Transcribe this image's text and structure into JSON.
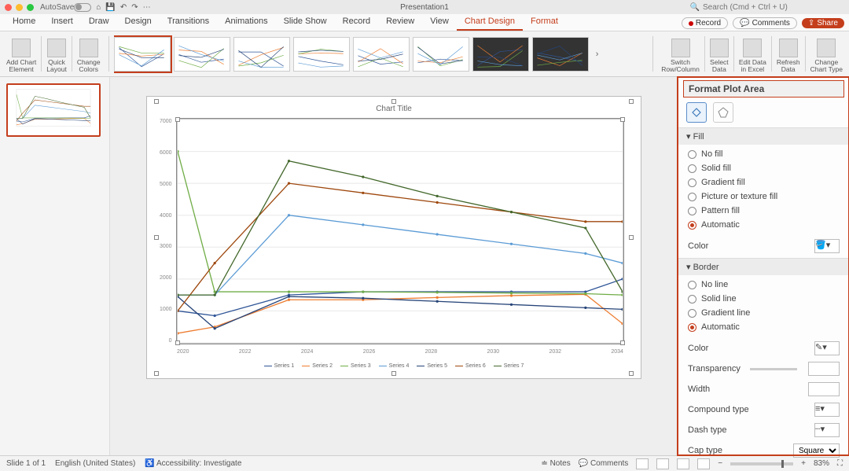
{
  "titlebar": {
    "autosave_label": "AutoSave",
    "doc_title": "Presentation1",
    "search_placeholder": "Search (Cmd + Ctrl + U)"
  },
  "tabs": {
    "items": [
      "Home",
      "Insert",
      "Draw",
      "Design",
      "Transitions",
      "Animations",
      "Slide Show",
      "Record",
      "Review",
      "View",
      "Chart Design",
      "Format"
    ],
    "active_index": 10,
    "record_label": "Record",
    "comments_label": "Comments",
    "share_label": "Share"
  },
  "ribbon": {
    "groups_left": [
      {
        "label": "Add Chart\nElement"
      },
      {
        "label": "Quick\nLayout"
      },
      {
        "label": "Change\nColors"
      }
    ],
    "groups_right": [
      {
        "label": "Switch\nRow/Column"
      },
      {
        "label": "Select\nData"
      },
      {
        "label": "Edit Data\nin Excel"
      },
      {
        "label": "Refresh\nData"
      },
      {
        "label": "Change\nChart Type"
      }
    ],
    "style_count": 8
  },
  "format_pane": {
    "title": "Format Plot Area",
    "section_fill": "Fill",
    "fill_options": [
      "No fill",
      "Solid fill",
      "Gradient fill",
      "Picture or texture fill",
      "Pattern fill",
      "Automatic"
    ],
    "fill_selected_index": 5,
    "color_label": "Color",
    "section_border": "Border",
    "border_options": [
      "No line",
      "Solid line",
      "Gradient line",
      "Automatic"
    ],
    "border_selected_index": 3,
    "color2_label": "Color",
    "transparency_label": "Transparency",
    "width_label": "Width",
    "compound_label": "Compound type",
    "dash_label": "Dash type",
    "cap_label": "Cap type",
    "cap_value": "Square"
  },
  "status": {
    "slide": "Slide 1 of 1",
    "lang": "English (United States)",
    "accessibility": "Accessibility: Investigate",
    "notes": "Notes",
    "comments": "Comments",
    "zoom": "83%"
  },
  "chart_data": {
    "type": "line",
    "title": "Chart Title",
    "xlabel": "",
    "ylabel": "",
    "categories": [
      "2020",
      "2022",
      "2024",
      "2026",
      "2028",
      "2030",
      "2032",
      "2034"
    ],
    "x": [
      2021,
      2022,
      2024,
      2026,
      2028,
      2030,
      2032,
      2033
    ],
    "ylim": [
      0,
      7000
    ],
    "yticks": [
      0,
      1000,
      2000,
      3000,
      4000,
      5000,
      6000,
      7000
    ],
    "series": [
      {
        "name": "Series 1",
        "color": "#2f5597",
        "values": [
          1000,
          850,
          1500,
          1600,
          1600,
          1600,
          1600,
          2000
        ]
      },
      {
        "name": "Series 2",
        "color": "#ed7d31",
        "values": [
          300,
          500,
          1350,
          1350,
          1420,
          1480,
          1520,
          600
        ]
      },
      {
        "name": "Series 3",
        "color": "#70ad47",
        "values": [
          6000,
          1600,
          1600,
          1600,
          1580,
          1560,
          1540,
          1500
        ]
      },
      {
        "name": "Series 4",
        "color": "#5b9bd5",
        "values": [
          1500,
          1500,
          4000,
          3700,
          3400,
          3100,
          2800,
          2500
        ]
      },
      {
        "name": "Series 5",
        "color": "#264478",
        "values": [
          1450,
          450,
          1450,
          1400,
          1300,
          1200,
          1100,
          1050
        ]
      },
      {
        "name": "Series 6",
        "color": "#9e480e",
        "values": [
          1000,
          2500,
          5000,
          4700,
          4400,
          4100,
          3800,
          3800
        ]
      },
      {
        "name": "Series 7",
        "color": "#43682b",
        "values": [
          1500,
          1500,
          5700,
          5200,
          4600,
          4100,
          3600,
          1600
        ]
      }
    ],
    "legend_labels": [
      "Series 1",
      "Series 2",
      "Series 3",
      "Series 4",
      "Series 5",
      "Series 6",
      "Series 7"
    ],
    "legend_colors": [
      "#2f5597",
      "#ed7d31",
      "#70ad47",
      "#5b9bd5",
      "#264478",
      "#9e480e",
      "#43682b"
    ]
  }
}
